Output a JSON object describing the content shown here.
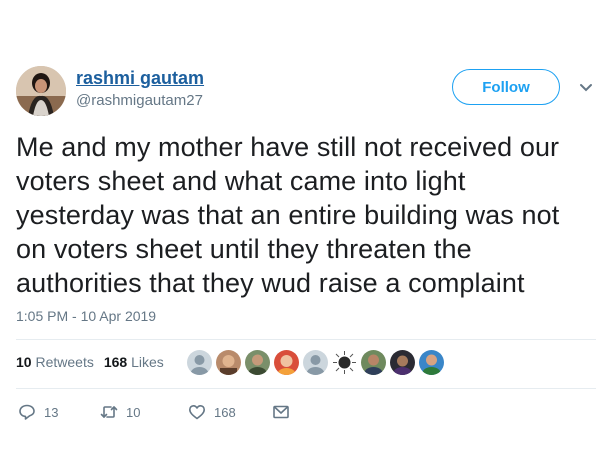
{
  "author": {
    "display_name": "rashmi gautam",
    "handle": "@rashmigautam27"
  },
  "follow_label": "Follow",
  "tweet": {
    "lines": [
      "Me and my mother have still not received our",
      "voters sheet and what came into light",
      "yesterday was that an entire building was not",
      "on voters sheet until they threaten the",
      "authorities that they wud raise a complaint"
    ],
    "timestamp": "1:05 PM - 10 Apr 2019"
  },
  "stats": {
    "retweets_count": "10",
    "retweets_label": "Retweets",
    "likes_count": "168",
    "likes_label": "Likes"
  },
  "actions": {
    "replies": "13",
    "retweets": "10",
    "likes": "168"
  },
  "colors": {
    "link": "#1c5f9e",
    "accent": "#1da1f2",
    "muted": "#657786",
    "divider": "#e6ecf0"
  },
  "icons": {
    "reply": "reply-icon",
    "retweet": "retweet-icon",
    "like": "heart-icon",
    "message": "direct-message-icon",
    "more": "chevron-down-icon"
  }
}
